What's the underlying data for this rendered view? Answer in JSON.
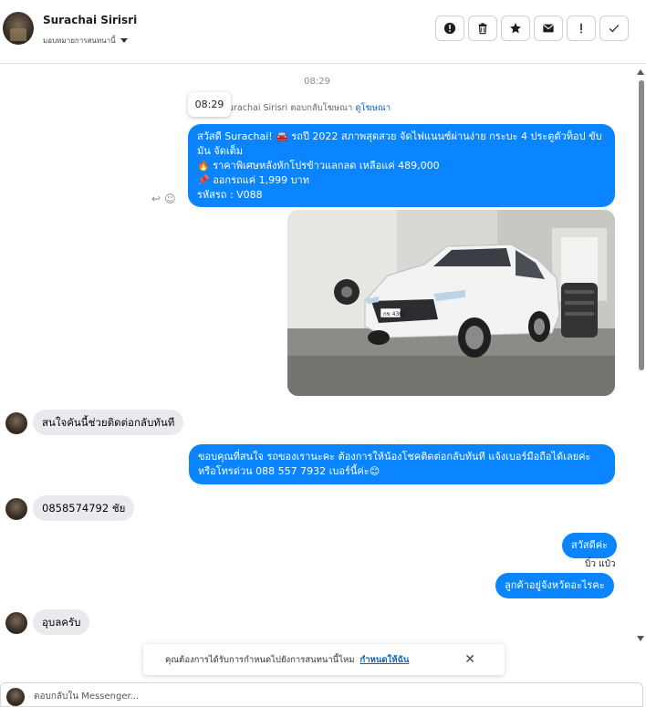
{
  "header": {
    "name": "Surachai Sirisri",
    "assign_label": "มอบหมายการสนทนานี้",
    "actions": [
      {
        "name": "report-button",
        "glyph": "!"
      },
      {
        "name": "delete-button",
        "glyph": "🗑"
      },
      {
        "name": "star-button",
        "glyph": "★"
      },
      {
        "name": "mark-unread-button",
        "glyph": "✉"
      },
      {
        "name": "spam-button",
        "glyph": "!"
      },
      {
        "name": "done-button",
        "glyph": "✓"
      }
    ]
  },
  "chat": {
    "timestamp": "08:29",
    "tooltip_time": "08:29",
    "reply_note": "urachai Sirisri ตอบกลับโฆษณา",
    "reply_link": "ดูโฆษณา",
    "ad_message": {
      "line1": "สวัสดี Surachai! 🚘 รถปี 2022 สภาพสุดสวย จัดไฟแนนซ์ผ่านง่าย กระบะ 4 ประตูตัวท็อป ขับ",
      "line2": "มัน จัดเต็ม",
      "line3": "🔥 ราคาพิเศษหลังหักโปรข้าวแลกลด เหลือแค่ 489,000",
      "line4": "📌 ออกรถแค่ 1,999 บาท",
      "line5": "รหัสรถ : V088"
    },
    "messages": [
      {
        "from": "customer",
        "text": "สนใจคันนี้ช่วยติดต่อกลับทันที"
      },
      {
        "from": "page",
        "line1": "ขอบคุณที่สนใจ รถของเรานะคะ ต้องการให้น้องโชคติดต่อกลับทันที แจ้งเบอร์มือถือได้เลยค่ะ",
        "line2": "หรือโทรด่วน 088 557 7932 เบอร์นี้ค่ะ😊"
      },
      {
        "from": "customer",
        "text": "0858574792 ชัย"
      },
      {
        "from": "page",
        "text": "สวัสดีค่ะ"
      },
      {
        "from": "page_sender",
        "text": "บิ๋ว แป๋ว"
      },
      {
        "from": "page",
        "text": "ลูกค้าอยู่จังหวัดอะไรคะ"
      },
      {
        "from": "customer",
        "text": "อุบลครับ"
      }
    ]
  },
  "toast": {
    "text": "คุณต้องการได้รับการกำหนดไปยังการสนทนานี้ไหม",
    "link": "กำหนดให้ฉัน"
  },
  "composer": {
    "placeholder": "ตอบกลับใน Messenger..."
  },
  "colors": {
    "outgoing_bubble": "#0a84ff",
    "incoming_bubble": "#e9eaed",
    "link": "#0a66c2"
  }
}
